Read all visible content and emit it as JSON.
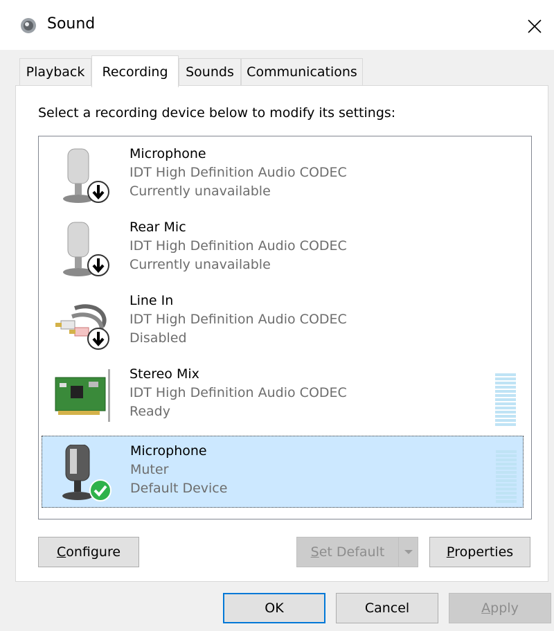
{
  "window": {
    "title": "Sound",
    "icon": "speaker-icon"
  },
  "tabs": [
    {
      "label": "Playback",
      "active": false
    },
    {
      "label": "Recording",
      "active": true
    },
    {
      "label": "Sounds",
      "active": false
    },
    {
      "label": "Communications",
      "active": false
    }
  ],
  "instruction": "Select a recording device below to modify its settings:",
  "devices": [
    {
      "name": "Microphone",
      "line1": "IDT High Definition Audio CODEC",
      "line2": "Currently unavailable",
      "icon": "microphone-icon",
      "badge": "down-arrow-badge-icon"
    },
    {
      "name": "Rear Mic",
      "line1": "IDT High Definition Audio CODEC",
      "line2": "Currently unavailable",
      "icon": "microphone-icon",
      "badge": "down-arrow-badge-icon"
    },
    {
      "name": "Line In",
      "line1": "IDT High Definition Audio CODEC",
      "line2": "Disabled",
      "icon": "rca-cable-icon",
      "badge": "down-arrow-badge-icon"
    },
    {
      "name": "Stereo Mix",
      "line1": "IDT High Definition Audio CODEC",
      "line2": "Ready",
      "icon": "sound-card-icon",
      "level_meter": true
    },
    {
      "name": "Microphone",
      "line1": "Muter",
      "line2": "Default Device",
      "icon": "microphone-icon",
      "badge": "green-check-badge-icon",
      "selected": true,
      "level_meter": true
    }
  ],
  "buttons": {
    "configure": {
      "mnemonic": "C",
      "rest": "onfigure"
    },
    "set_default": {
      "mnemonic": "S",
      "rest": "et Default"
    },
    "properties": {
      "mnemonic": "P",
      "rest": "roperties"
    },
    "ok": "OK",
    "cancel": "Cancel",
    "apply": {
      "mnemonic": "A",
      "rest": "pply"
    }
  },
  "colors": {
    "selection": "#cce8ff",
    "accent": "#0078d7",
    "level_meter": "#bfe3f5",
    "check_green": "#2fb24a"
  }
}
